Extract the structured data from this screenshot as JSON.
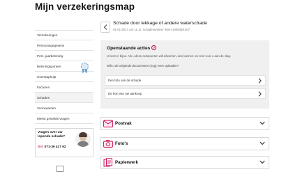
{
  "page": {
    "title": "Mijn verzekeringsmap"
  },
  "sidebar": {
    "items": [
      {
        "label": "Verzekeringen"
      },
      {
        "label": "Persoonsgegevens"
      },
      {
        "label": "Pers. jaarbeloning"
      },
      {
        "label": "Beloningspunten"
      },
      {
        "label": "Overstaphulp"
      },
      {
        "label": "Facturen"
      },
      {
        "label": "Schades"
      },
      {
        "label": "Voorwaarden"
      },
      {
        "label": "Meest gestelde vragen"
      }
    ],
    "badge_icon": "award-ribbon-icon"
  },
  "help": {
    "title": "Vragen over uw lopende schade?",
    "phone_label": "Bel:",
    "phone": "071-36 417 62"
  },
  "claim": {
    "title": "Schade door lekkage of andere waterschade",
    "subtitle": "01-01-2017 om 11.11, schadenummer INSH 1009358.007"
  },
  "actions": {
    "title": "Openstaande acties",
    "intro": "U bent er bijna. Als u deze actiepunten wilt afwerken, dan kunnen we snel voor u aan de slag.",
    "question": "Wilt u de volgende documenten (nog) even uploaden?",
    "items": [
      {
        "label": "Een foto van de schade"
      },
      {
        "label": "De bon van uw aankoop"
      }
    ]
  },
  "sections": [
    {
      "label": "Postvak",
      "icon": "mail-icon"
    },
    {
      "label": "Foto's",
      "icon": "camera-icon"
    },
    {
      "label": "Papierwerk",
      "icon": "document-icon"
    }
  ],
  "colors": {
    "accent": "#c8004b",
    "card_bg": "#f0f0f0",
    "border": "#d8d8d8"
  }
}
